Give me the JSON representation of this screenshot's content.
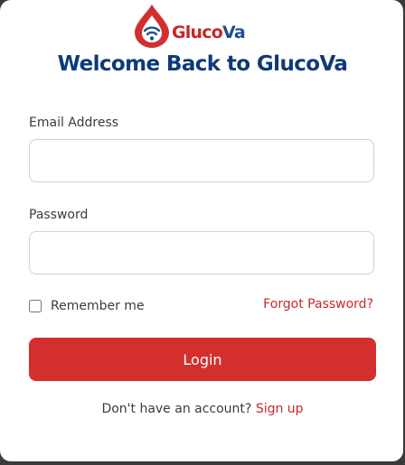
{
  "logo": {
    "text_part1": "Gluco",
    "text_part2": "Va",
    "icon": "blood-drop-wifi-icon"
  },
  "title": "Welcome Back to GlucoVa",
  "form": {
    "email_label": "Email Address",
    "email_value": "",
    "password_label": "Password",
    "password_value": "",
    "remember_label": "Remember me",
    "remember_checked": false,
    "forgot_label": "Forgot Password?",
    "login_label": "Login"
  },
  "footer": {
    "prompt": "Don't have an account?",
    "signup_label": "Sign up"
  },
  "colors": {
    "brand_red": "#d32f2f",
    "brand_blue": "#0e3a78",
    "link_red": "#c62828"
  }
}
